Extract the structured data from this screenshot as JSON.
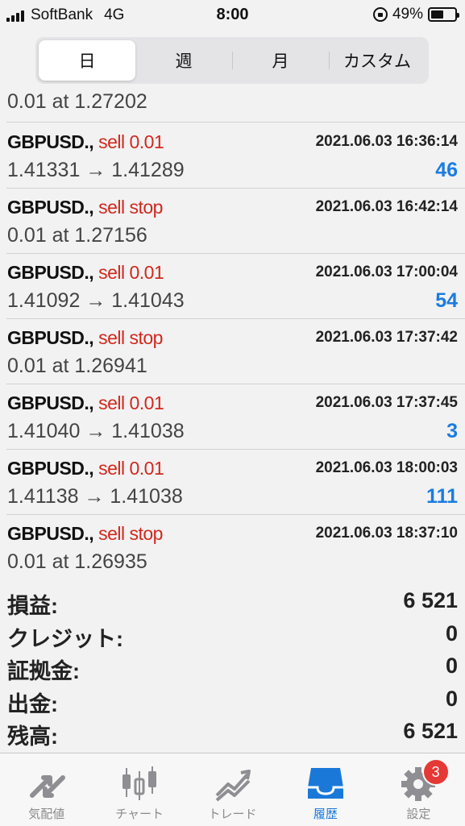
{
  "status_bar": {
    "carrier": "SoftBank",
    "network": "4G",
    "time": "8:00",
    "battery": "49%"
  },
  "period_tabs": [
    "日",
    "週",
    "月",
    "カスタム"
  ],
  "partial_row": {
    "detail": "0.01 at 1.27202"
  },
  "orders": [
    {
      "symbol": "GBPUSD.,",
      "action": "sell 0.01",
      "time": "2021.06.03 16:36:14",
      "detail": "1.41331 → 1.41289",
      "profit": "46"
    },
    {
      "symbol": "GBPUSD.,",
      "action": "sell stop",
      "time": "2021.06.03 16:42:14",
      "detail": "0.01 at 1.27156",
      "profit": ""
    },
    {
      "symbol": "GBPUSD.,",
      "action": "sell 0.01",
      "time": "2021.06.03 17:00:04",
      "detail": "1.41092 → 1.41043",
      "profit": "54"
    },
    {
      "symbol": "GBPUSD.,",
      "action": "sell stop",
      "time": "2021.06.03 17:37:42",
      "detail": "0.01 at 1.26941",
      "profit": ""
    },
    {
      "symbol": "GBPUSD.,",
      "action": "sell 0.01",
      "time": "2021.06.03 17:37:45",
      "detail": "1.41040 → 1.41038",
      "profit": "3"
    },
    {
      "symbol": "GBPUSD.,",
      "action": "sell 0.01",
      "time": "2021.06.03 18:00:03",
      "detail": "1.41138 → 1.41038",
      "profit": "111"
    },
    {
      "symbol": "GBPUSD.,",
      "action": "sell stop",
      "time": "2021.06.03 18:37:10",
      "detail": "0.01 at 1.26935",
      "profit": ""
    }
  ],
  "summary": [
    {
      "label": "損益:",
      "value": "6 521"
    },
    {
      "label": "クレジット:",
      "value": "0"
    },
    {
      "label": "証拠金:",
      "value": "0"
    },
    {
      "label": "出金:",
      "value": "0"
    },
    {
      "label": "残高:",
      "value": "6 521"
    }
  ],
  "tabbar": {
    "items": [
      {
        "label": "気配値",
        "icon": "quotes-icon"
      },
      {
        "label": "チャート",
        "icon": "candlestick-chart-icon"
      },
      {
        "label": "トレード",
        "icon": "trade-trend-icon"
      },
      {
        "label": "履歴",
        "icon": "history-inbox-icon"
      },
      {
        "label": "設定",
        "icon": "gear-icon"
      }
    ],
    "active": "履歴",
    "settings_badge": "3"
  },
  "colors": {
    "sell": "#d1281e",
    "profit": "#1c7ce0",
    "active_tab": "#1a78d8"
  }
}
